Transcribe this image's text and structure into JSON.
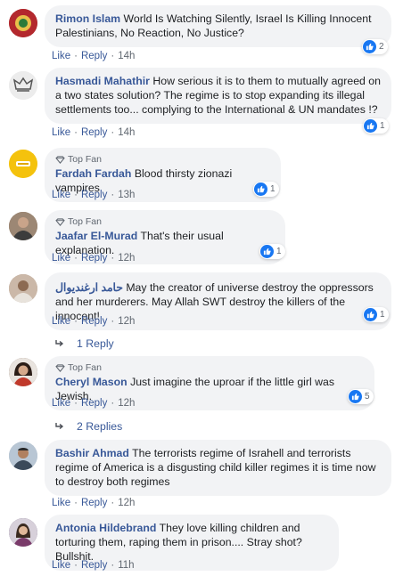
{
  "colors": {
    "author": "#385898",
    "bubble": "#f2f3f5",
    "like_blue": "#1877f2",
    "meta": "#606770"
  },
  "comments": [
    {
      "author": "Rimon Islam",
      "badge": "",
      "text": "World Is Watching Silently, Israel Is Killing Innocent Palestinians, No Reaction, No Justice?",
      "reactions": "2",
      "like": "Like",
      "reply": "Reply",
      "time": "14h",
      "avatar_icon": "avatar-red-emblem"
    },
    {
      "author": "Hasmadi Mahathir",
      "badge": "",
      "text": "How serious it is to them to mutually agreed on a two states solution? The regime is to stop expanding its illegal settlements too... complying to the International & UN mandates !?",
      "reactions": "1",
      "like": "Like",
      "reply": "Reply",
      "time": "14h",
      "avatar_icon": "avatar-sketch"
    },
    {
      "author": "Fardah Fardah",
      "badge": "Top Fan",
      "text": "Blood thirsty zionazi vampires",
      "reactions": "1",
      "like": "Like",
      "reply": "Reply",
      "time": "13h",
      "avatar_icon": "avatar-yellow-logo"
    },
    {
      "author": "Jaafar El-Murad",
      "badge": "Top Fan",
      "text": "That's their usual explanation.",
      "reactions": "1",
      "like": "Like",
      "reply": "Reply",
      "time": "12h",
      "avatar_icon": "avatar-photo"
    },
    {
      "author": "حامد ارغنديوال",
      "badge": "",
      "text": "May the creator of universe destroy the oppressors and her murderers. May Allah SWT destroy the killers of the innocent!",
      "reactions": "1",
      "like": "Like",
      "reply": "Reply",
      "time": "12h",
      "avatar_icon": "avatar-photo",
      "replies_label": "1 Reply"
    },
    {
      "author": "Cheryl Mason",
      "badge": "Top Fan",
      "text": "Just imagine the uproar if the little girl was Jewish.",
      "reactions": "5",
      "like": "Like",
      "reply": "Reply",
      "time": "12h",
      "avatar_icon": "avatar-photo",
      "replies_label": "2 Replies"
    },
    {
      "author": "Bashir Ahmad",
      "badge": "",
      "text": "The terrorists regime of Israhell and terrorists regime of America is a disgusting child killer regimes it is time now to destroy both regimes",
      "reactions": "",
      "like": "Like",
      "reply": "Reply",
      "time": "12h",
      "avatar_icon": "avatar-photo"
    },
    {
      "author": "Antonia Hildebrand",
      "badge": "",
      "text": "They love killing children and torturing them, raping them in prison.... Stray shot? Bullshit.",
      "reactions": "",
      "like": "Like",
      "reply": "Reply",
      "time": "11h",
      "avatar_icon": "avatar-photo"
    }
  ]
}
